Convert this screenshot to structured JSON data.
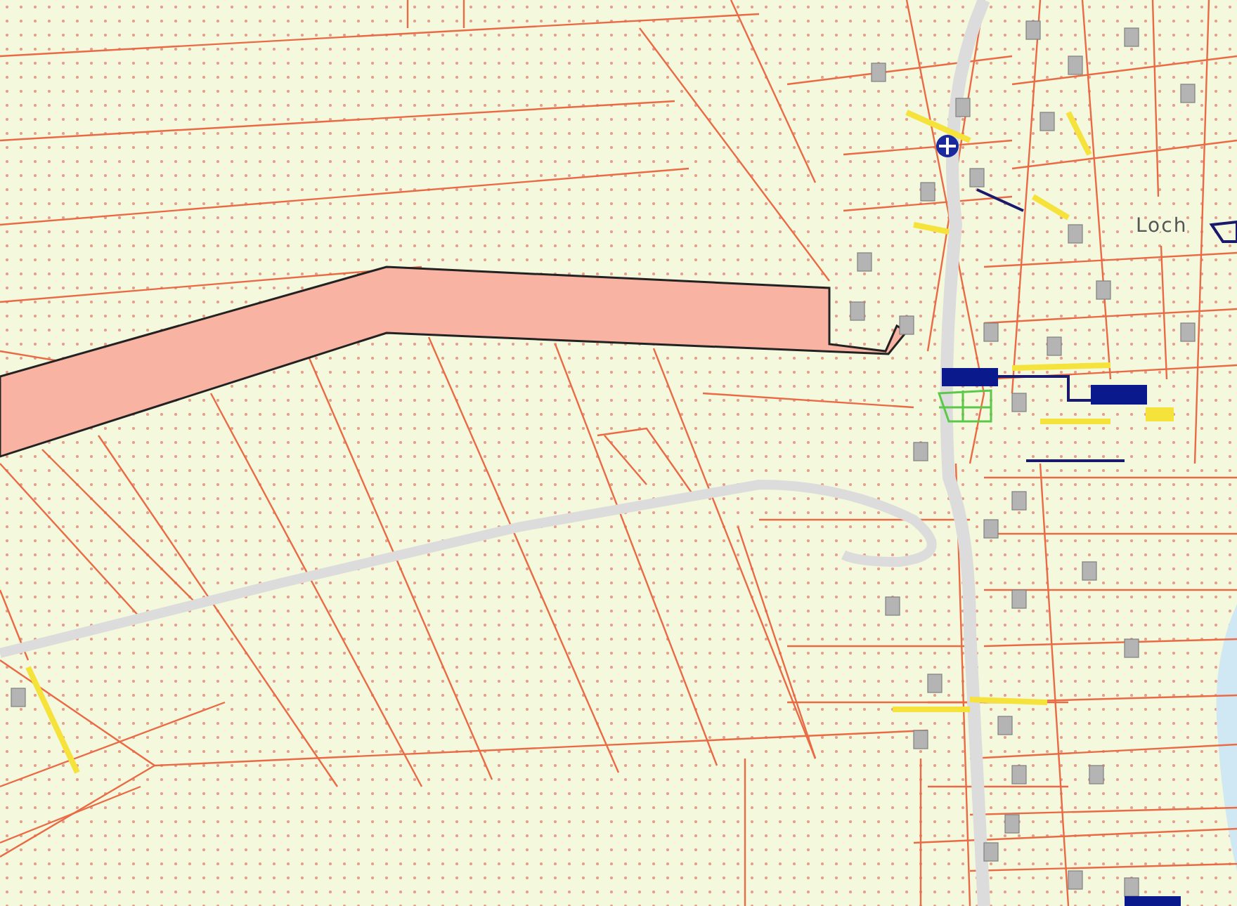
{
  "map": {
    "place_labels": [
      {
        "text": "Loch"
      }
    ]
  }
}
